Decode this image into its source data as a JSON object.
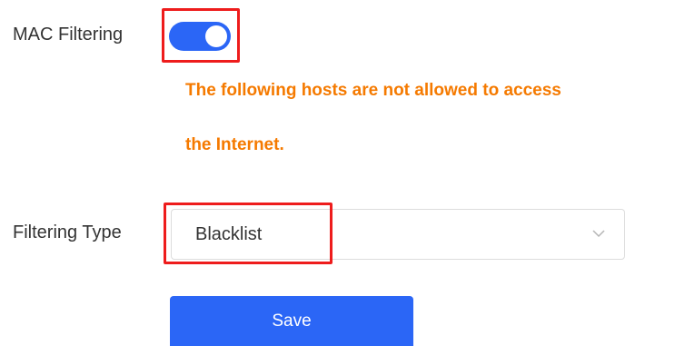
{
  "mac_filtering": {
    "label": "MAC Filtering",
    "enabled": true,
    "warning_line1": "The following hosts are not allowed to access",
    "warning_line2": "the Internet."
  },
  "filtering_type": {
    "label": "Filtering Type",
    "selected": "Blacklist",
    "chevron_icon": "chevron-down-icon"
  },
  "actions": {
    "save_label": "Save"
  },
  "colors": {
    "accent": "#2b66f6",
    "warning": "#f57a00",
    "highlight": "#ee1c1c"
  }
}
